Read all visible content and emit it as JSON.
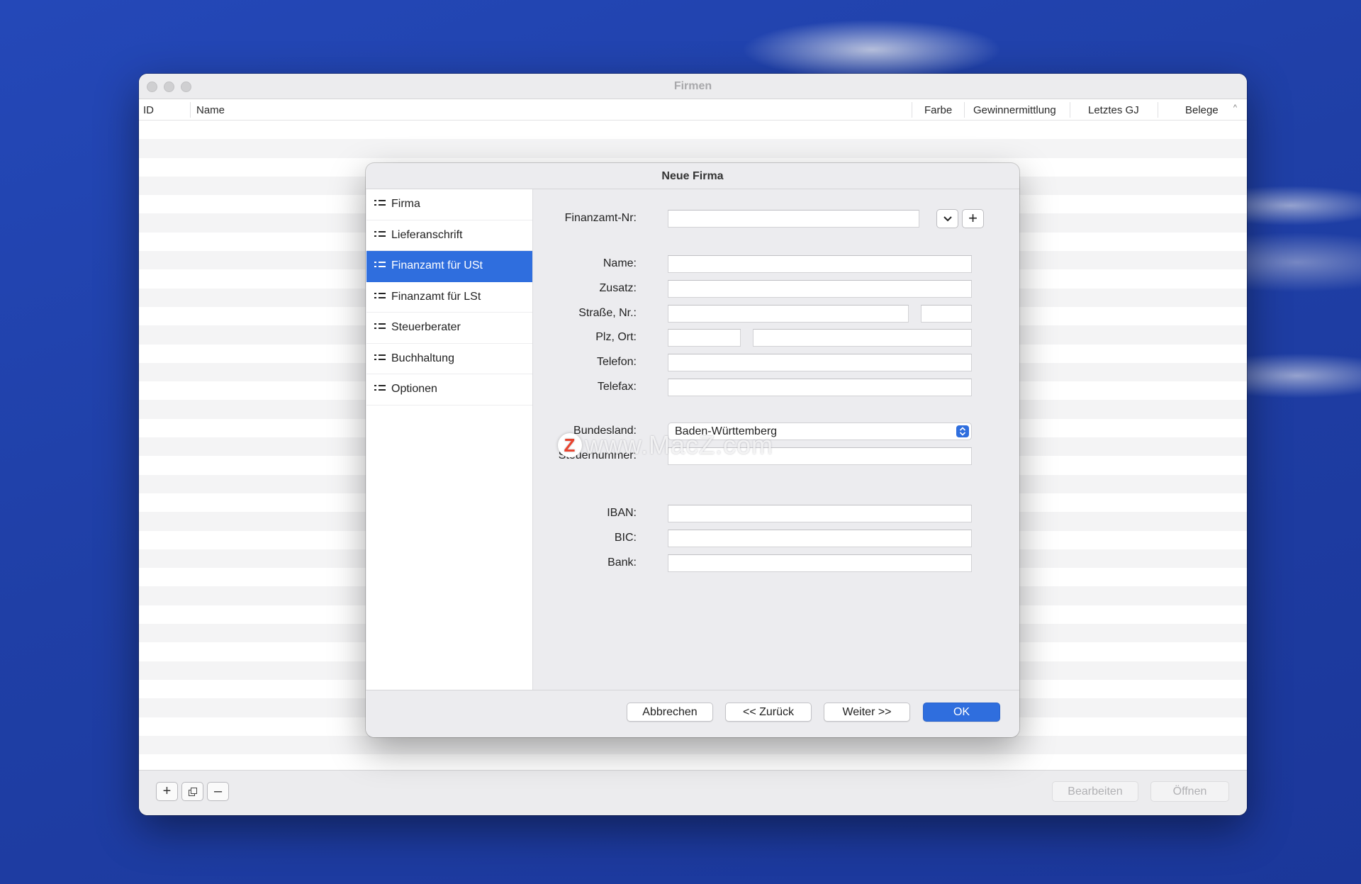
{
  "window": {
    "title": "Firmen",
    "columns": {
      "id": "ID",
      "name": "Name",
      "farbe": "Farbe",
      "gewinnermittlung": "Gewinnermittlung",
      "letztes_gj": "Letztes GJ",
      "belege": "Belege"
    },
    "bottom": {
      "add_label": "+",
      "duplicate_icon": "duplicate-icon",
      "remove_label": "–",
      "edit_label": "Bearbeiten",
      "open_label": "Öffnen"
    }
  },
  "dialog": {
    "title": "Neue Firma",
    "nav": [
      {
        "label": "Firma"
      },
      {
        "label": "Lieferanschrift"
      },
      {
        "label": "Finanzamt für USt"
      },
      {
        "label": "Finanzamt für LSt"
      },
      {
        "label": "Steuerberater"
      },
      {
        "label": "Buchhaltung"
      },
      {
        "label": "Optionen"
      }
    ],
    "active_nav_index": 2,
    "form": {
      "finanzamt_nr_label": "Finanzamt-Nr:",
      "name_label": "Name:",
      "zusatz_label": "Zusatz:",
      "strasse_label": "Straße, Nr.:",
      "plz_label": "Plz, Ort:",
      "telefon_label": "Telefon:",
      "telefax_label": "Telefax:",
      "bundesland_label": "Bundesland:",
      "bundesland_value": "Baden-Württemberg",
      "steuernummer_label": "Steuernummer:",
      "iban_label": "IBAN:",
      "bic_label": "BIC:",
      "bank_label": "Bank:",
      "add_button_label": "+"
    },
    "buttons": {
      "cancel": "Abbrechen",
      "back": "<< Zurück",
      "next": "Weiter >>",
      "ok": "OK"
    }
  },
  "watermark": {
    "logo_letter": "Z",
    "text": "www.MacZ.com"
  },
  "colors": {
    "accent": "#2f6ede",
    "desktop": "#1f3fa8"
  }
}
